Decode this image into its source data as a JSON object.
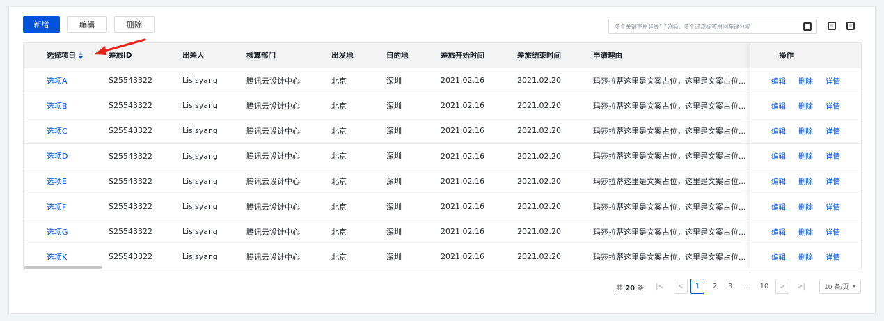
{
  "toolbar": {
    "add": "新增",
    "edit": "编辑",
    "delete": "删除"
  },
  "search": {
    "placeholder": "多个关键字用竖线“|”分隔，多个过滤标签用回车键分隔"
  },
  "table": {
    "columns": [
      "选择项目",
      "差旅ID",
      "出差人",
      "核算部门",
      "出发地",
      "目的地",
      "差旅开始时间",
      "差旅结束时间",
      "申请理由",
      "操作"
    ],
    "rows": [
      {
        "item": "选项A",
        "id": "S25543322",
        "person": "Lisjsyang",
        "dept": "腾讯云设计中心",
        "from": "北京",
        "to": "深圳",
        "start": "2021.02.16",
        "end": "2021.02.20",
        "reason": "玛莎拉蒂这里是文案占位，这里是文案占位..."
      },
      {
        "item": "选项B",
        "id": "S25543322",
        "person": "Lisjsyang",
        "dept": "腾讯云设计中心",
        "from": "北京",
        "to": "深圳",
        "start": "2021.02.16",
        "end": "2021.02.20",
        "reason": "玛莎拉蒂这里是文案占位，这里是文案占位..."
      },
      {
        "item": "选项C",
        "id": "S25543322",
        "person": "Lisjsyang",
        "dept": "腾讯云设计中心",
        "from": "北京",
        "to": "深圳",
        "start": "2021.02.16",
        "end": "2021.02.20",
        "reason": "玛莎拉蒂这里是文案占位，这里是文案占位..."
      },
      {
        "item": "选项D",
        "id": "S25543322",
        "person": "Lisjsyang",
        "dept": "腾讯云设计中心",
        "from": "北京",
        "to": "深圳",
        "start": "2021.02.16",
        "end": "2021.02.20",
        "reason": "玛莎拉蒂这里是文案占位，这里是文案占位..."
      },
      {
        "item": "选项E",
        "id": "S25543322",
        "person": "Lisjsyang",
        "dept": "腾讯云设计中心",
        "from": "北京",
        "to": "深圳",
        "start": "2021.02.16",
        "end": "2021.02.20",
        "reason": "玛莎拉蒂这里是文案占位，这里是文案占位..."
      },
      {
        "item": "选项F",
        "id": "S25543322",
        "person": "Lisjsyang",
        "dept": "腾讯云设计中心",
        "from": "北京",
        "to": "深圳",
        "start": "2021.02.16",
        "end": "2021.02.20",
        "reason": "玛莎拉蒂这里是文案占位，这里是文案占位..."
      },
      {
        "item": "选项G",
        "id": "S25543322",
        "person": "Lisjsyang",
        "dept": "腾讯云设计中心",
        "from": "北京",
        "to": "深圳",
        "start": "2021.02.16",
        "end": "2021.02.20",
        "reason": "玛莎拉蒂这里是文案占位，这里是文案占位..."
      },
      {
        "item": "选项K",
        "id": "S25543322",
        "person": "Lisjsyang",
        "dept": "腾讯云设计中心",
        "from": "北京",
        "to": "深圳",
        "start": "2021.02.16",
        "end": "2021.02.20",
        "reason": "玛莎拉蒂这里是文案占位，这里是文案占位..."
      }
    ],
    "actions": [
      "编辑",
      "删除",
      "详情"
    ]
  },
  "pagination": {
    "total_prefix": "共",
    "total": "20",
    "total_suffix": "条",
    "pages": [
      "1",
      "2",
      "3",
      "...",
      "10"
    ],
    "current": "1",
    "page_size": "10 条/页"
  },
  "colors": {
    "primary": "#0052d9",
    "annotation": "#e8231a"
  }
}
